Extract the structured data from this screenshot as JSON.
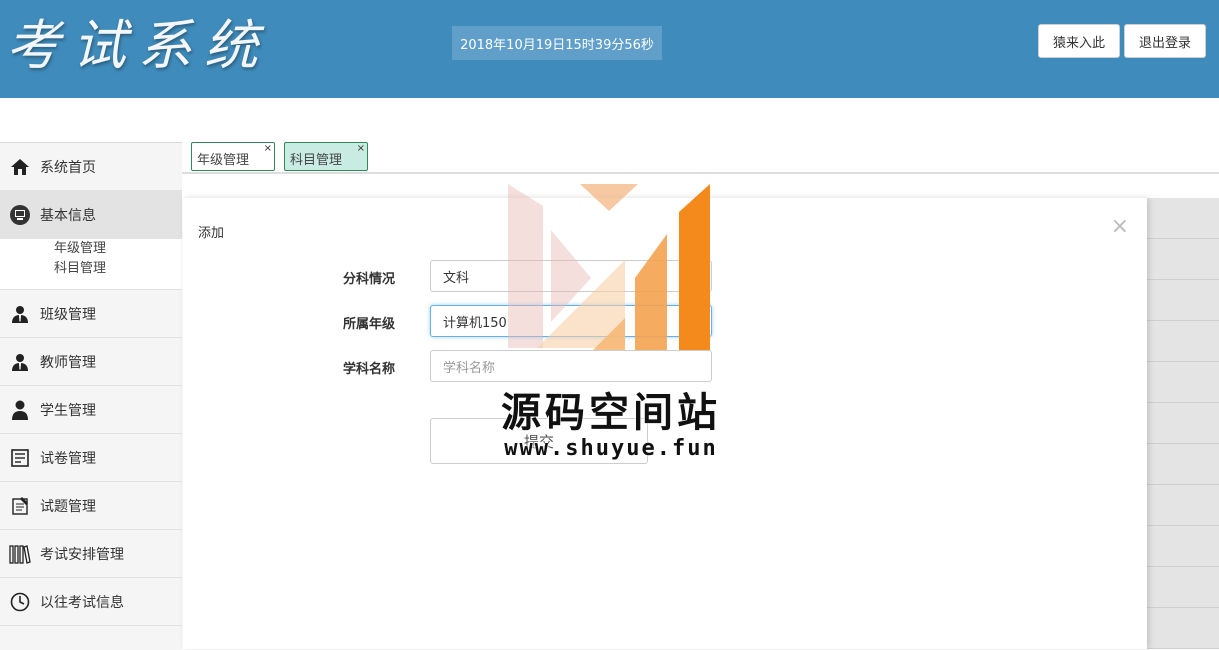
{
  "header": {
    "logo_text": "考试系统",
    "datetime": "2018年10月19日15时39分56秒",
    "buttons": [
      {
        "label": "猿来入此"
      },
      {
        "label": "退出登录"
      }
    ],
    "colors": {
      "bar": "#3f8bbb",
      "clock_bg": "#5f9fca"
    }
  },
  "sidebar": {
    "items": [
      {
        "label": "系统首页",
        "icon": "home-icon"
      },
      {
        "label": "基本信息",
        "icon": "monitor-icon",
        "active": true
      },
      {
        "label": "班级管理",
        "icon": "user-tie-icon"
      },
      {
        "label": "教师管理",
        "icon": "user-tie-icon"
      },
      {
        "label": "学生管理",
        "icon": "user-icon"
      },
      {
        "label": "试卷管理",
        "icon": "document-list-icon"
      },
      {
        "label": "试题管理",
        "icon": "notepad-icon"
      },
      {
        "label": "考试安排管理",
        "icon": "books-icon"
      },
      {
        "label": "以往考试信息",
        "icon": "clock-icon"
      }
    ],
    "subitems": [
      {
        "label": "年级管理"
      },
      {
        "label": "科目管理"
      }
    ]
  },
  "tabs": [
    {
      "label": "年级管理",
      "close": "×"
    },
    {
      "label": "科目管理",
      "close": "×",
      "active": true
    }
  ],
  "modal": {
    "title": "添加",
    "close": "×",
    "fields": [
      {
        "label": "分科情况",
        "value": "文科",
        "type": "select"
      },
      {
        "label": "所属年级",
        "value": "计算机150",
        "type": "select"
      },
      {
        "label": "学科名称",
        "placeholder": "学科名称",
        "type": "input"
      }
    ],
    "submit_label": "提交"
  },
  "watermark": {
    "title": "源码空间站",
    "url": "www.shuyue.fun"
  }
}
